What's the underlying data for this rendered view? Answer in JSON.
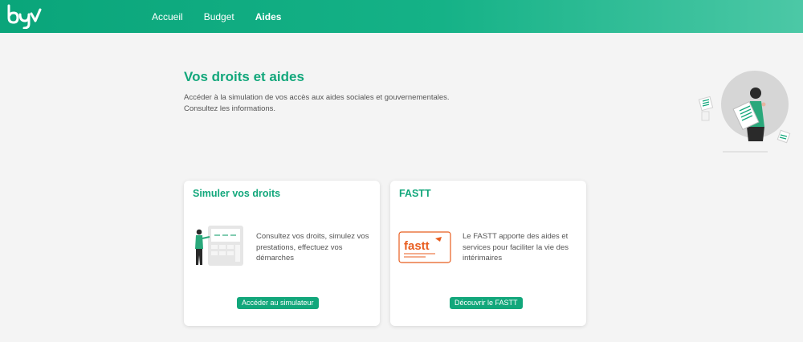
{
  "header": {
    "nav": [
      {
        "label": "Accueil"
      },
      {
        "label": "Budget"
      },
      {
        "label": "Aides",
        "active": true
      }
    ]
  },
  "hero": {
    "title": "Vos droits et aides",
    "description_line1": "Accéder à la simulation de vos accès aux aides sociales et gouvernementales.",
    "description_line2": "Consultez les informations."
  },
  "cards": [
    {
      "title": "Simuler vos droits",
      "text": "Consultez vos droits, simulez vos prestations, effectuez vos démarches",
      "button": "Accéder au simulateur",
      "icon": "simulator-illustration"
    },
    {
      "title": "FASTT",
      "text": "Le FASTT apporte des aides et services pour faciliter la vie des intérimaires",
      "button": "Découvrir le FASTT",
      "logo_text": "fastt"
    }
  ],
  "colors": {
    "brand_green": "#12a77b",
    "header_gradient_start": "#0aa57a",
    "header_gradient_end": "#4cc8a6",
    "fastt_orange": "#e85d1f"
  }
}
